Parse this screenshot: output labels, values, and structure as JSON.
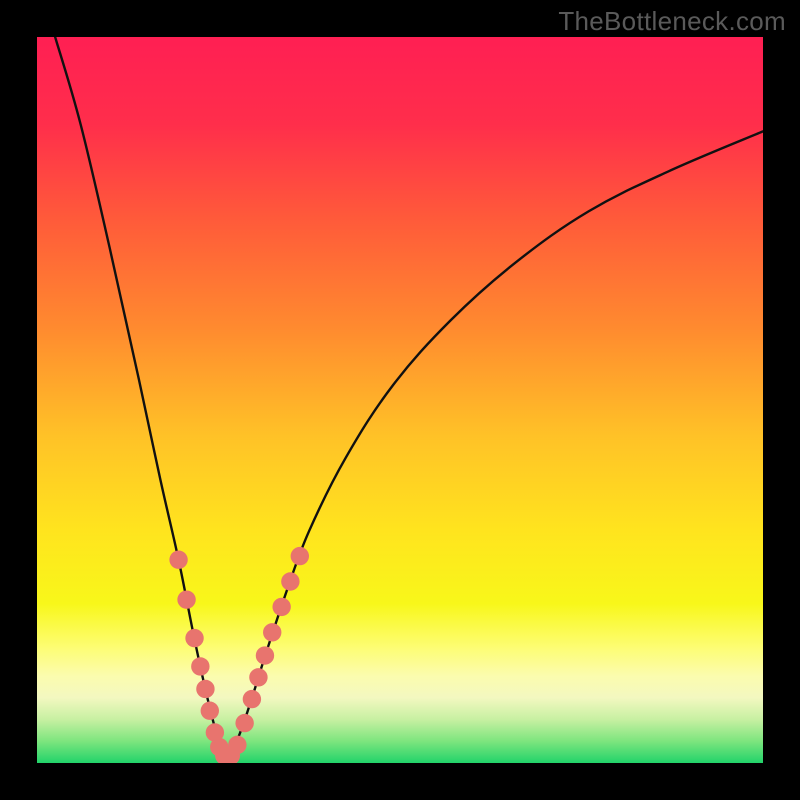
{
  "watermark": "TheBottleneck.com",
  "frame": {
    "px": 37,
    "size": 726
  },
  "gradient": {
    "stops": [
      {
        "offset": 0.0,
        "color": "#ff1f53"
      },
      {
        "offset": 0.12,
        "color": "#ff2e4b"
      },
      {
        "offset": 0.25,
        "color": "#ff5a3a"
      },
      {
        "offset": 0.4,
        "color": "#ff8a2f"
      },
      {
        "offset": 0.55,
        "color": "#ffc227"
      },
      {
        "offset": 0.68,
        "color": "#ffe41e"
      },
      {
        "offset": 0.78,
        "color": "#f8f71a"
      },
      {
        "offset": 0.84,
        "color": "#fdfd72"
      },
      {
        "offset": 0.88,
        "color": "#fbfcae"
      },
      {
        "offset": 0.91,
        "color": "#f3f8c0"
      },
      {
        "offset": 0.94,
        "color": "#c7f0a2"
      },
      {
        "offset": 0.97,
        "color": "#7de57e"
      },
      {
        "offset": 1.0,
        "color": "#22d36a"
      }
    ]
  },
  "curve": {
    "color": "#111111",
    "width": 2.4,
    "vertex_x": 0.26,
    "left_points": [
      {
        "x": 0.025,
        "y": 0.0
      },
      {
        "x": 0.06,
        "y": 0.12
      },
      {
        "x": 0.1,
        "y": 0.29
      },
      {
        "x": 0.14,
        "y": 0.47
      },
      {
        "x": 0.17,
        "y": 0.61
      },
      {
        "x": 0.195,
        "y": 0.72
      },
      {
        "x": 0.215,
        "y": 0.82
      },
      {
        "x": 0.23,
        "y": 0.89
      },
      {
        "x": 0.242,
        "y": 0.94
      },
      {
        "x": 0.252,
        "y": 0.975
      },
      {
        "x": 0.26,
        "y": 0.992
      }
    ],
    "right_points": [
      {
        "x": 0.26,
        "y": 0.992
      },
      {
        "x": 0.275,
        "y": 0.97
      },
      {
        "x": 0.293,
        "y": 0.92
      },
      {
        "x": 0.315,
        "y": 0.85
      },
      {
        "x": 0.345,
        "y": 0.76
      },
      {
        "x": 0.375,
        "y": 0.68
      },
      {
        "x": 0.425,
        "y": 0.58
      },
      {
        "x": 0.49,
        "y": 0.48
      },
      {
        "x": 0.57,
        "y": 0.39
      },
      {
        "x": 0.66,
        "y": 0.31
      },
      {
        "x": 0.76,
        "y": 0.24
      },
      {
        "x": 0.87,
        "y": 0.185
      },
      {
        "x": 1.0,
        "y": 0.13
      }
    ]
  },
  "markers": {
    "color": "#e8746e",
    "radius": 9.2,
    "points": [
      {
        "x": 0.195,
        "y": 0.72
      },
      {
        "x": 0.206,
        "y": 0.775
      },
      {
        "x": 0.217,
        "y": 0.828
      },
      {
        "x": 0.225,
        "y": 0.867
      },
      {
        "x": 0.232,
        "y": 0.898
      },
      {
        "x": 0.238,
        "y": 0.928
      },
      {
        "x": 0.245,
        "y": 0.958
      },
      {
        "x": 0.251,
        "y": 0.978
      },
      {
        "x": 0.258,
        "y": 0.99
      },
      {
        "x": 0.267,
        "y": 0.99
      },
      {
        "x": 0.276,
        "y": 0.975
      },
      {
        "x": 0.286,
        "y": 0.945
      },
      {
        "x": 0.296,
        "y": 0.912
      },
      {
        "x": 0.305,
        "y": 0.882
      },
      {
        "x": 0.314,
        "y": 0.852
      },
      {
        "x": 0.324,
        "y": 0.82
      },
      {
        "x": 0.337,
        "y": 0.785
      },
      {
        "x": 0.349,
        "y": 0.75
      },
      {
        "x": 0.362,
        "y": 0.715
      }
    ]
  },
  "chart_data": {
    "type": "line",
    "title": "",
    "xlabel": "",
    "ylabel": "",
    "xlim": [
      0,
      1
    ],
    "ylim": [
      0,
      1
    ],
    "note": "Bottleneck V-curve plotted on a red-to-green vertical gradient. x is normalized component ratio, y is normalized bottleneck metric where 1 = worst (top, red) and 0 = best (bottom, green). Vertex near x≈0.26.",
    "series": [
      {
        "name": "bottleneck_curve",
        "x": [
          0.025,
          0.06,
          0.1,
          0.14,
          0.17,
          0.195,
          0.215,
          0.23,
          0.242,
          0.252,
          0.26,
          0.275,
          0.293,
          0.315,
          0.345,
          0.375,
          0.425,
          0.49,
          0.57,
          0.66,
          0.76,
          0.87,
          1.0
        ],
        "y": [
          1.0,
          0.88,
          0.71,
          0.53,
          0.39,
          0.28,
          0.18,
          0.11,
          0.06,
          0.025,
          0.008,
          0.03,
          0.08,
          0.15,
          0.24,
          0.32,
          0.42,
          0.52,
          0.61,
          0.69,
          0.76,
          0.815,
          0.87
        ]
      },
      {
        "name": "highlighted_points",
        "x": [
          0.195,
          0.206,
          0.217,
          0.225,
          0.232,
          0.238,
          0.245,
          0.251,
          0.258,
          0.267,
          0.276,
          0.286,
          0.296,
          0.305,
          0.314,
          0.324,
          0.337,
          0.349,
          0.362
        ],
        "y": [
          0.28,
          0.225,
          0.172,
          0.133,
          0.102,
          0.072,
          0.042,
          0.022,
          0.01,
          0.01,
          0.025,
          0.055,
          0.088,
          0.118,
          0.148,
          0.18,
          0.215,
          0.25,
          0.285
        ]
      }
    ]
  }
}
